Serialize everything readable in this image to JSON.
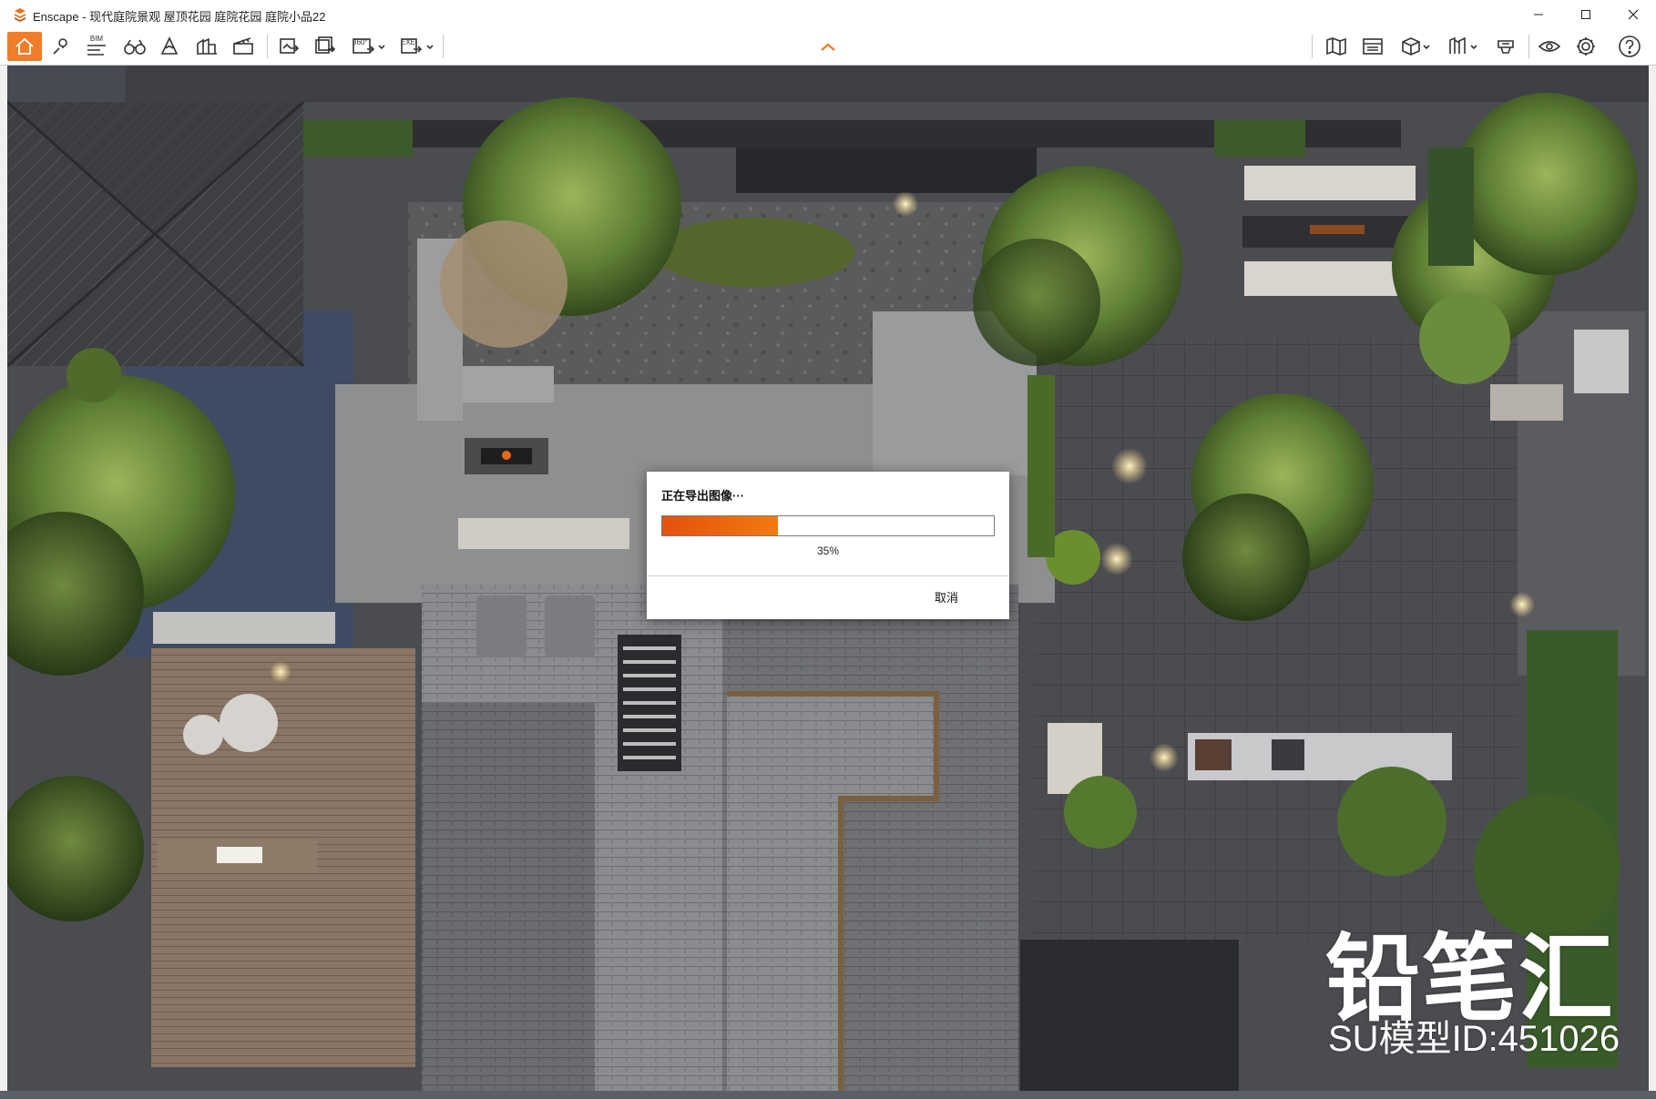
{
  "window": {
    "title": "Enscape - 现代庭院景观 屋顶花园 庭院花园 庭院小品22",
    "controls": [
      "minimize-icon",
      "maximize-icon",
      "close-icon"
    ]
  },
  "toolbar": {
    "left_icons": [
      "home-icon",
      "location-pin-icon",
      "bim-icon",
      "binoculars-icon",
      "atmosphere-icon",
      "asset-library-icon",
      "video-editor-icon",
      "screenshot-export-icon",
      "batch-render-icon",
      "panorama-360-icon",
      "exe-export-icon"
    ],
    "bim_label": "BIM",
    "panorama_label": "360°",
    "exe_label": "EXE",
    "center_icon": "collapse-chevron-up-icon",
    "right_icons": [
      "map-icon",
      "views-icon",
      "cube-view-icon",
      "material-editor-icon",
      "vr-headset-icon",
      "visibility-eye-icon",
      "settings-gear-icon",
      "help-icon"
    ],
    "accent_color": "#ef7d2a"
  },
  "dialog": {
    "title": "正在导出图像···",
    "progress": 0.35,
    "progress_text": "35%",
    "cancel_label": "取消",
    "fill_color": "#ee5d0f"
  },
  "watermark": {
    "brand": "铅笔汇",
    "model_id": "SU模型ID:451026"
  }
}
